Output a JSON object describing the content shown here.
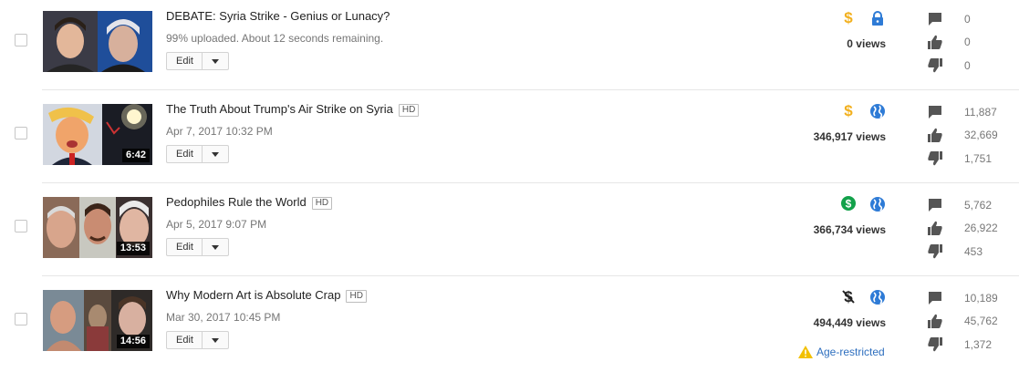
{
  "videos": [
    {
      "title": "DEBATE: Syria Strike - Genius or Lunacy?",
      "hd": "",
      "subtitle": "99% uploaded. About 12 seconds remaining.",
      "duration": "",
      "edit_label": "Edit",
      "monetization_icon": "dollar-sign-yellow",
      "visibility_icon": "lock-icon",
      "views": "0 views",
      "age_restricted": "",
      "comments": "0",
      "likes": "0",
      "dislikes": "0"
    },
    {
      "title": "The Truth About Trump's Air Strike on Syria",
      "hd": "HD",
      "subtitle": "Apr 7, 2017 10:32 PM",
      "duration": "6:42",
      "edit_label": "Edit",
      "monetization_icon": "dollar-sign-yellow",
      "visibility_icon": "globe-icon",
      "views": "346,917 views",
      "age_restricted": "",
      "comments": "11,887",
      "likes": "32,669",
      "dislikes": "1,751"
    },
    {
      "title": "Pedophiles Rule the World",
      "hd": "HD",
      "subtitle": "Apr 5, 2017 9:07 PM",
      "duration": "13:53",
      "edit_label": "Edit",
      "monetization_icon": "dollar-circle-green",
      "visibility_icon": "globe-icon",
      "views": "366,734 views",
      "age_restricted": "",
      "comments": "5,762",
      "likes": "26,922",
      "dislikes": "453"
    },
    {
      "title": "Why Modern Art is Absolute Crap",
      "hd": "HD",
      "subtitle": "Mar 30, 2017 10:45 PM",
      "duration": "14:56",
      "edit_label": "Edit",
      "monetization_icon": "dollar-strikethrough",
      "visibility_icon": "globe-icon",
      "views": "494,449 views",
      "age_restricted": "Age-restricted",
      "comments": "10,189",
      "likes": "45,762",
      "dislikes": "1,372"
    }
  ],
  "colors": {
    "monetized_yellow": "#f2b01e",
    "monetized_green": "#12a14a",
    "visibility_blue": "#2e7bd6",
    "stat_icon": "#555555",
    "warning_yellow": "#f2c000",
    "link_blue": "#2e6fbf"
  }
}
